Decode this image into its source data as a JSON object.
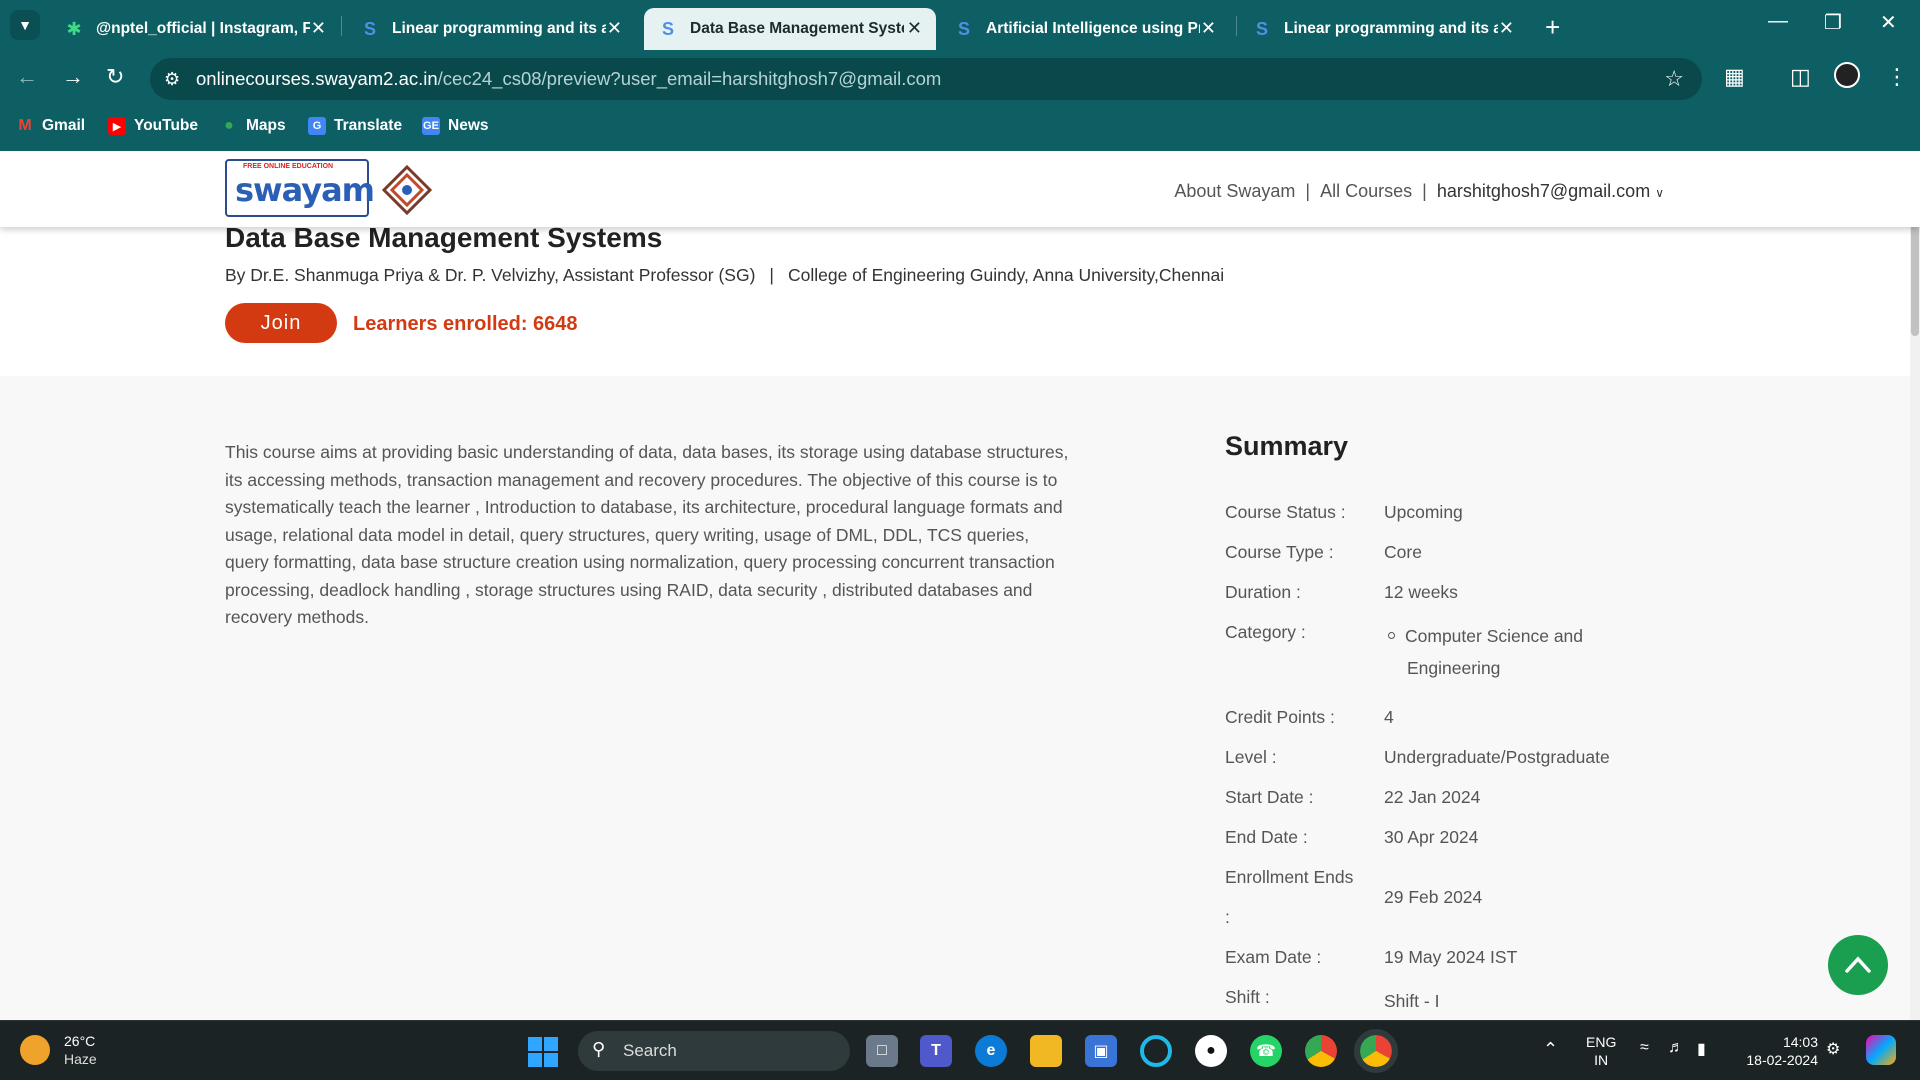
{
  "browser": {
    "tabs": [
      {
        "title": "@nptel_official | Instagram, Fa",
        "icon": "asterisk-icon",
        "active": false
      },
      {
        "title": "Linear programming and its ap",
        "icon": "swayam-icon",
        "active": false
      },
      {
        "title": "Data Base Management Systen",
        "icon": "swayam-icon",
        "active": true
      },
      {
        "title": "Artificial Intelligence using Pro",
        "icon": "swayam-icon",
        "active": false
      },
      {
        "title": "Linear programming and its ap",
        "icon": "swayam-icon",
        "active": false
      }
    ],
    "url_host": "onlinecourses.swayam2.ac.in",
    "url_path": "/cec24_cs08/preview?user_email=harshitghosh7@gmail.com",
    "bookmarks": [
      {
        "label": "Gmail",
        "icon": "gmail-icon",
        "color": "#ea4335"
      },
      {
        "label": "YouTube",
        "icon": "youtube-icon",
        "color": "#ff0000"
      },
      {
        "label": "Maps",
        "icon": "maps-icon",
        "color": "#34a853"
      },
      {
        "label": "Translate",
        "icon": "translate-icon",
        "color": "#4285f4"
      },
      {
        "label": "News",
        "icon": "news-icon",
        "color": "#4285f4"
      }
    ]
  },
  "site": {
    "logo_text": "swayam",
    "logo_tagline": "FREE ONLINE EDUCATION",
    "nav": {
      "about": "About Swayam",
      "sep": "|",
      "courses": "All Courses",
      "user": "harshitghosh7@gmail.com"
    }
  },
  "course": {
    "title": "Data Base Management Systems",
    "instructors": "By Dr.E. Shanmuga Priya & Dr. P. Velvizhy, Assistant Professor (SG)",
    "separator": "|",
    "institute": "College of Engineering Guindy, Anna University,Chennai",
    "join_label": "Join",
    "enrolled": "Learners enrolled: 6648",
    "description": "This course aims at providing basic understanding of data, data bases, its storage using database structures, its accessing methods, transaction management and recovery procedures.  The objective of this course is to systematically teach the learner ,  Introduction to database, its architecture, procedural language formats and usage, relational data model in detail, query structures, query writing, usage of DML, DDL, TCS queries, query formatting, data base structure creation using normalization, query processing concurrent transaction processing, deadlock handling , storage structures using RAID, data security , distributed databases and recovery methods."
  },
  "summary": {
    "title": "Summary",
    "status_k": "Course Status :",
    "status_v": "Upcoming",
    "type_k": "Course Type :",
    "type_v": "Core",
    "duration_k": "Duration :",
    "duration_v": "12 weeks",
    "category_k": "Category :",
    "category_v1": "Computer Science and",
    "category_v2": "Engineering",
    "credit_k": "Credit Points :",
    "credit_v": "4",
    "level_k": "Level :",
    "level_v": "Undergraduate/Postgraduate",
    "start_k": "Start Date :",
    "start_v": "22 Jan 2024",
    "end_k": "End Date :",
    "end_v": "30 Apr 2024",
    "enroll_k1": "Enrollment Ends",
    "enroll_k2": ":",
    "enroll_v": "29 Feb 2024",
    "exam_k": "Exam Date :",
    "exam_v": "19 May 2024 IST",
    "shift_k": "Shift :",
    "shift_v": "Shift - I"
  },
  "taskbar": {
    "temp": "26°C",
    "condition": "Haze",
    "search_label": "Search",
    "lang1": "ENG",
    "lang2": "IN",
    "time": "14:03",
    "date": "18-02-2024"
  }
}
